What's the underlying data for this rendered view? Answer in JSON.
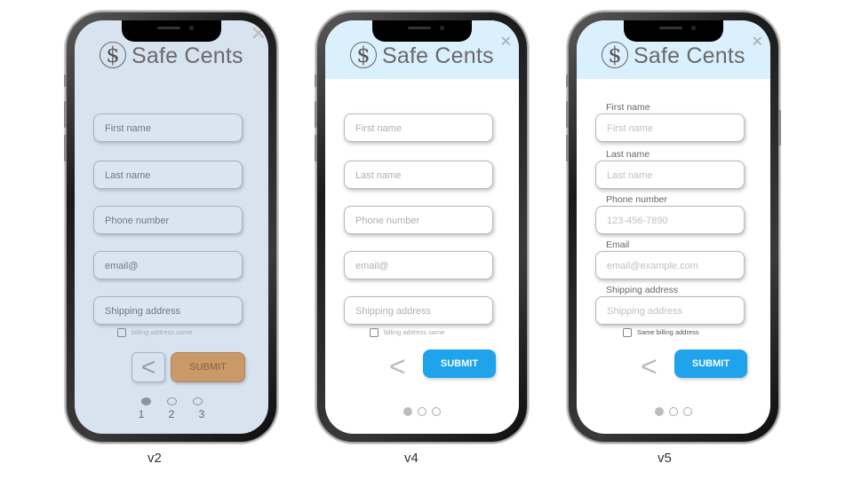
{
  "brand": {
    "name": "Safe Cents",
    "logo_glyph": "$",
    "close_glyph": "✕"
  },
  "variants": [
    {
      "caption": "v2",
      "fields": [
        "First name",
        "Last name",
        "Phone number",
        "email@",
        "Shipping address"
      ],
      "checkbox_label": "billing address same",
      "back_glyph": "<",
      "submit_label": "SUBMIT",
      "page_numbers": [
        "1",
        "2",
        "3"
      ],
      "active_page": 1,
      "colors": {
        "background": "#d8e3f0",
        "submit": "#c99968"
      }
    },
    {
      "caption": "v4",
      "fields": [
        "First name",
        "Last name",
        "Phone number",
        "email@",
        "Shipping address"
      ],
      "checkbox_label": "billing address same",
      "back_glyph": "<",
      "submit_label": "SUBMIT",
      "active_page": 1,
      "colors": {
        "header": "#daf0fd",
        "submit": "#1ea3ec"
      }
    },
    {
      "caption": "v5",
      "labels": [
        "First name",
        "Last name",
        "Phone number",
        "Email",
        "Shipping address"
      ],
      "placeholders": [
        "First name",
        "Last name",
        "123-456-7890",
        "email@example.com",
        "Shipping address"
      ],
      "checkbox_label": "Same billing address",
      "back_glyph": "<",
      "submit_label": "SUBMIT",
      "active_page": 1,
      "colors": {
        "header": "#daf0fd",
        "submit": "#1ea3ec"
      }
    }
  ]
}
